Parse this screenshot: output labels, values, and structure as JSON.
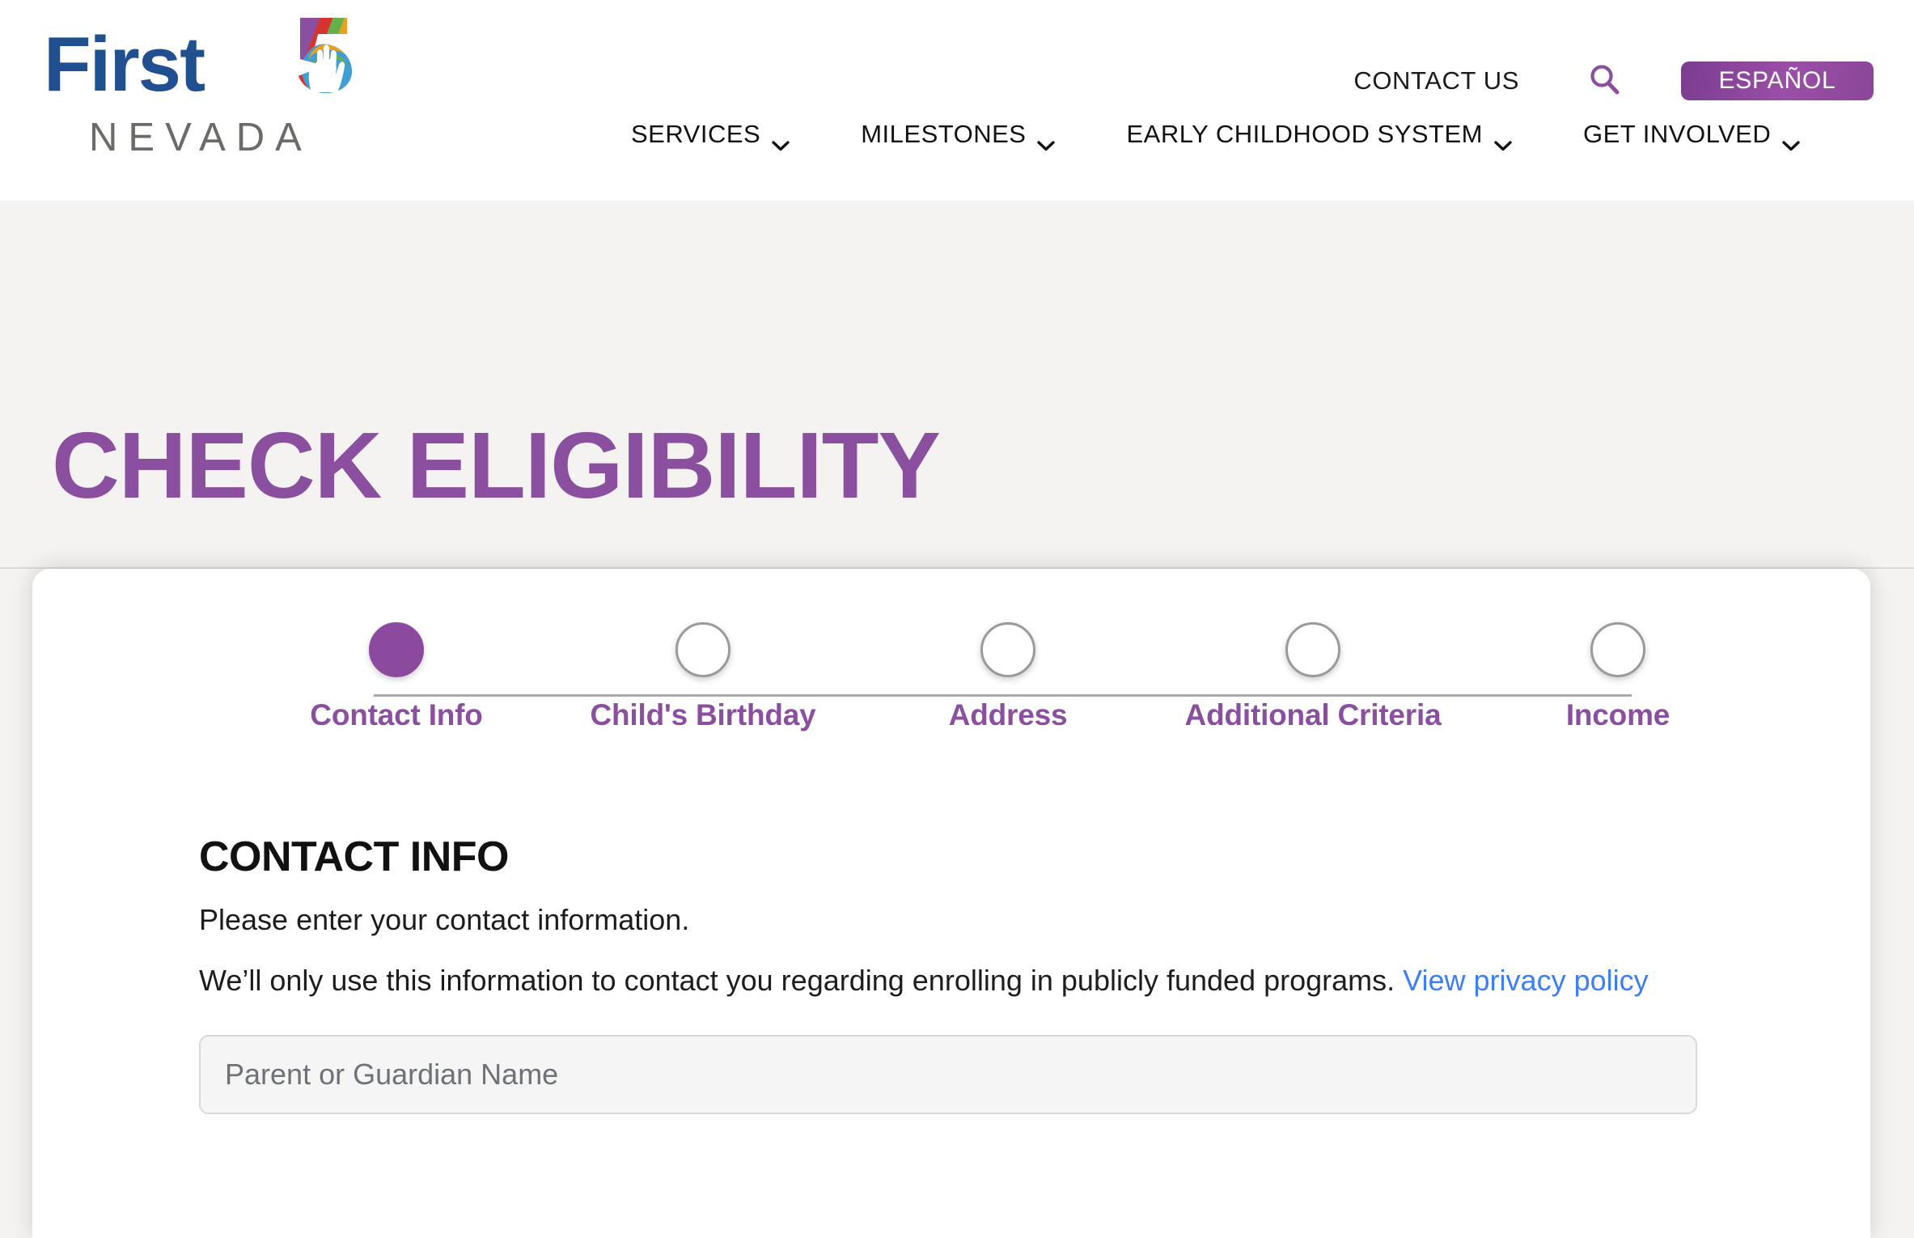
{
  "header": {
    "logo": {
      "word_first": "First",
      "word_nevada": "NEVADA",
      "mark_icon": "first5-handprint-logo"
    },
    "utility": {
      "contact_label": "CONTACT US",
      "search_icon": "search-icon",
      "language_label": "ESPAÑOL"
    },
    "nav": [
      {
        "label": "SERVICES",
        "icon": "chevron-down-icon"
      },
      {
        "label": "MILESTONES",
        "icon": "chevron-down-icon"
      },
      {
        "label": "EARLY CHILDHOOD SYSTEM",
        "icon": "chevron-down-icon"
      },
      {
        "label": "GET INVOLVED",
        "icon": "chevron-down-icon"
      }
    ]
  },
  "hero": {
    "title": "CHECK ELIGIBILITY"
  },
  "stepper": {
    "active_index": 0,
    "steps": [
      {
        "label": "Contact Info"
      },
      {
        "label": "Child's Birthday"
      },
      {
        "label": "Address"
      },
      {
        "label": "Additional Criteria"
      },
      {
        "label": "Income"
      }
    ]
  },
  "form": {
    "heading": "CONTACT INFO",
    "subtitle": "Please enter your contact information.",
    "note_text": "We’ll only use this information to contact you regarding enrolling in publicly funded programs.",
    "privacy_link_label": "View privacy policy",
    "fields": [
      {
        "placeholder": "Parent or Guardian Name",
        "value": ""
      }
    ]
  },
  "colors": {
    "brand_purple": "#8b4f9f",
    "step_active": "#8b4a9e",
    "logo_blue": "#20508f",
    "logo_gray": "#6b6b68",
    "link_blue": "#3b7ff5",
    "hero_bg": "#f4f3f1",
    "input_bg": "#f5f5f5"
  }
}
